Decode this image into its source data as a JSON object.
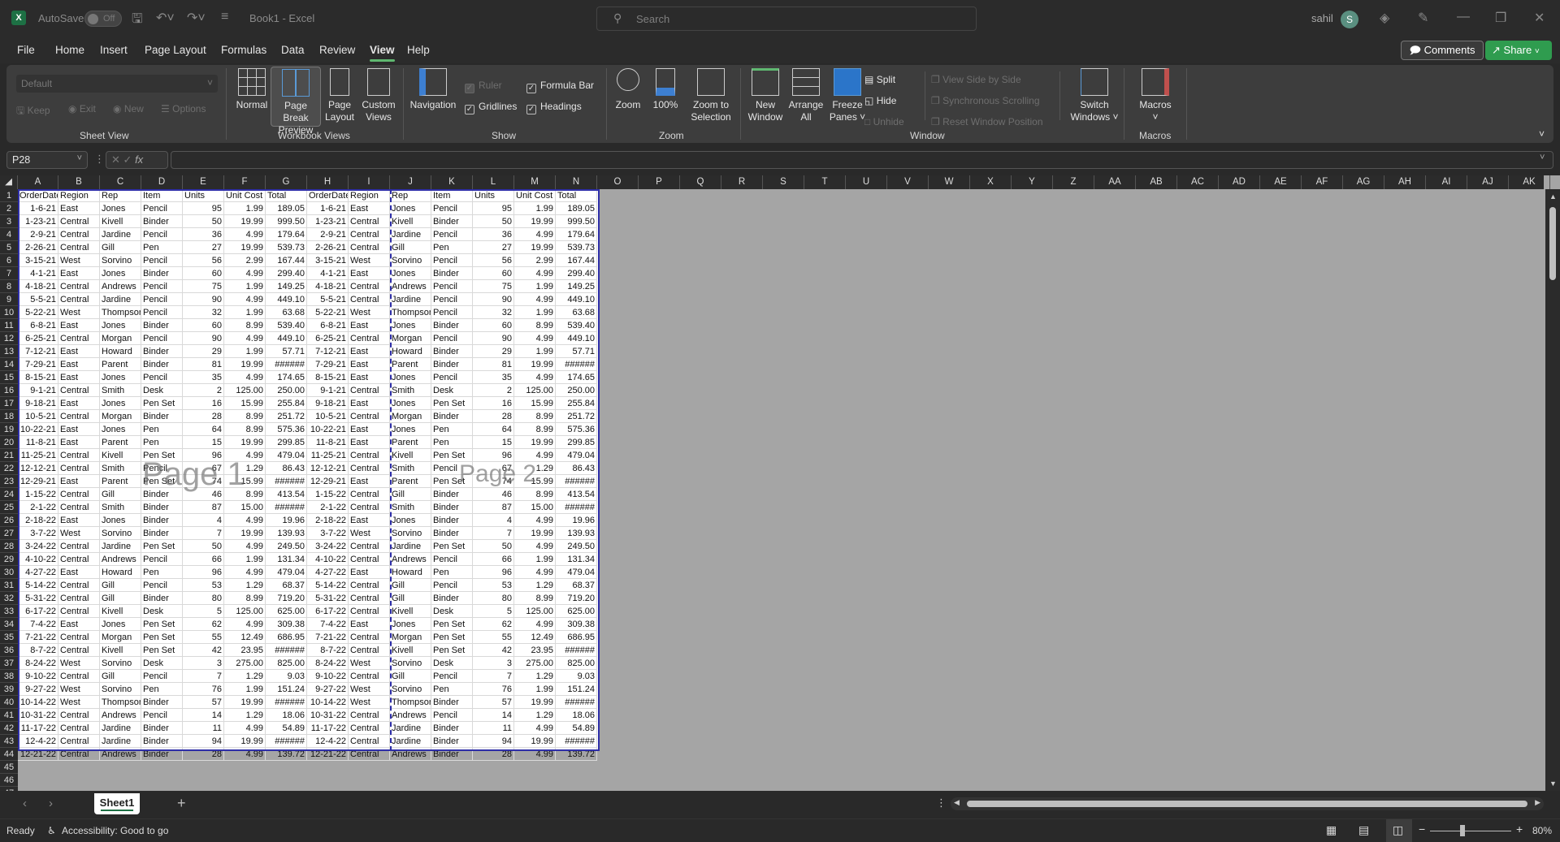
{
  "titlebar": {
    "autosave_label": "AutoSave",
    "autosave_state": "Off",
    "doc_title": "Book1  -  Excel",
    "search_placeholder": "Search",
    "user_name": "sahil",
    "user_initial": "S"
  },
  "menu": {
    "tabs": [
      "File",
      "Home",
      "Insert",
      "Page Layout",
      "Formulas",
      "Data",
      "Review",
      "View",
      "Help"
    ],
    "active": "View",
    "comments_label": "Comments",
    "share_label": "Share"
  },
  "ribbon": {
    "sheet_view": {
      "select_value": "Default",
      "keep": "Keep",
      "exit": "Exit",
      "new": "New",
      "options": "Options",
      "group_label": "Sheet View"
    },
    "workbook_views": {
      "normal": "Normal",
      "page_break_1": "Page Break",
      "page_break_2": "Preview",
      "page_layout_1": "Page",
      "page_layout_2": "Layout",
      "custom_1": "Custom",
      "custom_2": "Views",
      "group_label": "Workbook Views"
    },
    "show": {
      "navigation": "Navigation",
      "ruler": "Ruler",
      "ruler_checked": true,
      "gridlines": "Gridlines",
      "gridlines_checked": true,
      "formula_bar": "Formula Bar",
      "formula_bar_checked": true,
      "headings": "Headings",
      "headings_checked": true,
      "group_label": "Show"
    },
    "zoom": {
      "zoom": "Zoom",
      "hundred": "100%",
      "zoom_sel_1": "Zoom to",
      "zoom_sel_2": "Selection",
      "group_label": "Zoom"
    },
    "window": {
      "new_window_1": "New",
      "new_window_2": "Window",
      "arrange_1": "Arrange",
      "arrange_2": "All",
      "freeze_1": "Freeze",
      "freeze_2": "Panes ˅",
      "split": "Split",
      "hide": "Hide",
      "unhide": "Unhide",
      "side_by_side": "View Side by Side",
      "sync_scroll": "Synchronous Scrolling",
      "reset_pos": "Reset Window Position",
      "switch_1": "Switch",
      "switch_2": "Windows ˅",
      "group_label": "Window"
    },
    "macros": {
      "label": "Macros",
      "group_label": "Macros"
    }
  },
  "formula_bar": {
    "name_box": "P28",
    "formula": ""
  },
  "columns": [
    "A",
    "B",
    "C",
    "D",
    "E",
    "F",
    "G",
    "H",
    "I",
    "J",
    "K",
    "L",
    "M",
    "N",
    "O",
    "P",
    "Q",
    "R",
    "S",
    "T",
    "U",
    "V",
    "W",
    "X",
    "Y",
    "Z",
    "AA",
    "AB",
    "AC",
    "AD",
    "AE",
    "AF",
    "AG",
    "AH",
    "AI",
    "AJ",
    "AK"
  ],
  "headers": [
    "OrderDate",
    "Region",
    "Rep",
    "Item",
    "Units",
    "Unit Cost",
    "Total",
    "OrderDate",
    "Region",
    "Rep",
    "Item",
    "Units",
    "Unit Cost",
    "Total"
  ],
  "rows": [
    [
      "1-6-21",
      "East",
      "Jones",
      "Pencil",
      "95",
      "1.99",
      "189.05"
    ],
    [
      "1-23-21",
      "Central",
      "Kivell",
      "Binder",
      "50",
      "19.99",
      "999.50"
    ],
    [
      "2-9-21",
      "Central",
      "Jardine",
      "Pencil",
      "36",
      "4.99",
      "179.64"
    ],
    [
      "2-26-21",
      "Central",
      "Gill",
      "Pen",
      "27",
      "19.99",
      "539.73"
    ],
    [
      "3-15-21",
      "West",
      "Sorvino",
      "Pencil",
      "56",
      "2.99",
      "167.44"
    ],
    [
      "4-1-21",
      "East",
      "Jones",
      "Binder",
      "60",
      "4.99",
      "299.40"
    ],
    [
      "4-18-21",
      "Central",
      "Andrews",
      "Pencil",
      "75",
      "1.99",
      "149.25"
    ],
    [
      "5-5-21",
      "Central",
      "Jardine",
      "Pencil",
      "90",
      "4.99",
      "449.10"
    ],
    [
      "5-22-21",
      "West",
      "Thompson",
      "Pencil",
      "32",
      "1.99",
      "63.68"
    ],
    [
      "6-8-21",
      "East",
      "Jones",
      "Binder",
      "60",
      "8.99",
      "539.40"
    ],
    [
      "6-25-21",
      "Central",
      "Morgan",
      "Pencil",
      "90",
      "4.99",
      "449.10"
    ],
    [
      "7-12-21",
      "East",
      "Howard",
      "Binder",
      "29",
      "1.99",
      "57.71"
    ],
    [
      "7-29-21",
      "East",
      "Parent",
      "Binder",
      "81",
      "19.99",
      "######"
    ],
    [
      "8-15-21",
      "East",
      "Jones",
      "Pencil",
      "35",
      "4.99",
      "174.65"
    ],
    [
      "9-1-21",
      "Central",
      "Smith",
      "Desk",
      "2",
      "125.00",
      "250.00"
    ],
    [
      "9-18-21",
      "East",
      "Jones",
      "Pen Set",
      "16",
      "15.99",
      "255.84"
    ],
    [
      "10-5-21",
      "Central",
      "Morgan",
      "Binder",
      "28",
      "8.99",
      "251.72"
    ],
    [
      "10-22-21",
      "East",
      "Jones",
      "Pen",
      "64",
      "8.99",
      "575.36"
    ],
    [
      "11-8-21",
      "East",
      "Parent",
      "Pen",
      "15",
      "19.99",
      "299.85"
    ],
    [
      "11-25-21",
      "Central",
      "Kivell",
      "Pen Set",
      "96",
      "4.99",
      "479.04"
    ],
    [
      "12-12-21",
      "Central",
      "Smith",
      "Pencil",
      "67",
      "1.29",
      "86.43"
    ],
    [
      "12-29-21",
      "East",
      "Parent",
      "Pen Set",
      "74",
      "15.99",
      "######"
    ],
    [
      "1-15-22",
      "Central",
      "Gill",
      "Binder",
      "46",
      "8.99",
      "413.54"
    ],
    [
      "2-1-22",
      "Central",
      "Smith",
      "Binder",
      "87",
      "15.00",
      "######"
    ],
    [
      "2-18-22",
      "East",
      "Jones",
      "Binder",
      "4",
      "4.99",
      "19.96"
    ],
    [
      "3-7-22",
      "West",
      "Sorvino",
      "Binder",
      "7",
      "19.99",
      "139.93"
    ],
    [
      "3-24-22",
      "Central",
      "Jardine",
      "Pen Set",
      "50",
      "4.99",
      "249.50"
    ],
    [
      "4-10-22",
      "Central",
      "Andrews",
      "Pencil",
      "66",
      "1.99",
      "131.34"
    ],
    [
      "4-27-22",
      "East",
      "Howard",
      "Pen",
      "96",
      "4.99",
      "479.04"
    ],
    [
      "5-14-22",
      "Central",
      "Gill",
      "Pencil",
      "53",
      "1.29",
      "68.37"
    ],
    [
      "5-31-22",
      "Central",
      "Gill",
      "Binder",
      "80",
      "8.99",
      "719.20"
    ],
    [
      "6-17-22",
      "Central",
      "Kivell",
      "Desk",
      "5",
      "125.00",
      "625.00"
    ],
    [
      "7-4-22",
      "East",
      "Jones",
      "Pen Set",
      "62",
      "4.99",
      "309.38"
    ],
    [
      "7-21-22",
      "Central",
      "Morgan",
      "Pen Set",
      "55",
      "12.49",
      "686.95"
    ],
    [
      "8-7-22",
      "Central",
      "Kivell",
      "Pen Set",
      "42",
      "23.95",
      "######"
    ],
    [
      "8-24-22",
      "West",
      "Sorvino",
      "Desk",
      "3",
      "275.00",
      "825.00"
    ],
    [
      "9-10-22",
      "Central",
      "Gill",
      "Pencil",
      "7",
      "1.29",
      "9.03"
    ],
    [
      "9-27-22",
      "West",
      "Sorvino",
      "Pen",
      "76",
      "1.99",
      "151.24"
    ],
    [
      "10-14-22",
      "West",
      "Thompson",
      "Binder",
      "57",
      "19.99",
      "######"
    ],
    [
      "10-31-22",
      "Central",
      "Andrews",
      "Pencil",
      "14",
      "1.29",
      "18.06"
    ],
    [
      "11-17-22",
      "Central",
      "Jardine",
      "Binder",
      "11",
      "4.99",
      "54.89"
    ],
    [
      "12-4-22",
      "Central",
      "Jardine",
      "Binder",
      "94",
      "19.99",
      "######"
    ],
    [
      "12-21-22",
      "Central",
      "Andrews",
      "Binder",
      "28",
      "4.99",
      "139.72"
    ]
  ],
  "total_rows_shown": 47,
  "watermarks": {
    "page1": "Page 1",
    "page2": "Page 2"
  },
  "sheet_tabs": {
    "tabs": [
      "Sheet1"
    ],
    "active": "Sheet1",
    "add": "+"
  },
  "status": {
    "ready": "Ready",
    "accessibility": "Accessibility: Good to go",
    "zoom_level": "80%",
    "zoom_fraction": 0.4
  },
  "colors": {
    "accent": "#1d7044",
    "share": "#2f9c4f",
    "page_border": "#2e2ea8"
  }
}
